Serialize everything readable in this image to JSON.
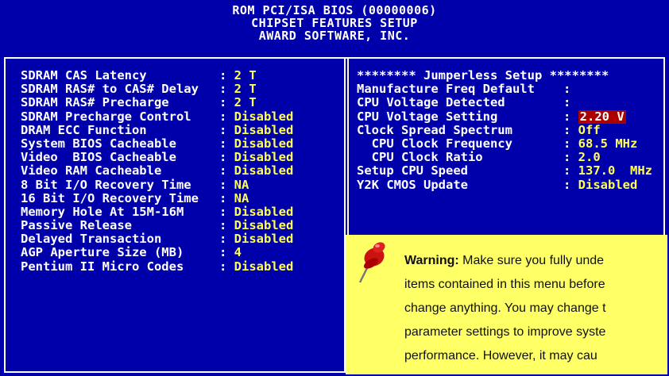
{
  "header": {
    "line1": "ROM PCI/ISA BIOS (00000006)",
    "line2": "CHIPSET FEATURES SETUP",
    "line3": "AWARD SOFTWARE, INC."
  },
  "left_items": [
    {
      "label": "SDRAM CAS Latency",
      "value": "2 T"
    },
    {
      "label": "SDRAM RAS# to CAS# Delay",
      "value": "2 T"
    },
    {
      "label": "SDRAM RAS# Precharge",
      "value": "2 T"
    },
    {
      "label": "SDRAM Precharge Control",
      "value": "Disabled"
    },
    {
      "label": "DRAM ECC Function",
      "value": "Disabled"
    },
    {
      "label": "System BIOS Cacheable",
      "value": "Disabled"
    },
    {
      "label": "Video  BIOS Cacheable",
      "value": "Disabled"
    },
    {
      "label": "Video RAM Cacheable",
      "value": "Disabled"
    },
    {
      "label": "8 Bit I/O Recovery Time",
      "value": "NA"
    },
    {
      "label": "16 Bit I/O Recovery Time",
      "value": "NA"
    },
    {
      "label": "Memory Hole At 15M-16M",
      "value": "Disabled"
    },
    {
      "label": "Passive Release",
      "value": "Disabled"
    },
    {
      "label": "Delayed Transaction",
      "value": "Disabled"
    },
    {
      "label": "AGP Aperture Size (MB)",
      "value": "4"
    },
    {
      "label": "Pentium II Micro Codes",
      "value": "Disabled"
    }
  ],
  "right_items": [
    {
      "label": "******** Jumperless Setup ********",
      "value": ""
    },
    {
      "label": "Manufacture Freq Default",
      "value": ""
    },
    {
      "label": "CPU Voltage Detected",
      "value": ""
    },
    {
      "label": "CPU Voltage Setting",
      "value": "2.20 V"
    },
    {
      "label": "Clock Spread Spectrum",
      "value": "Off"
    },
    {
      "label": "  CPU Clock Frequency",
      "value": "68.5 MHz"
    },
    {
      "label": "  CPU Clock Ratio",
      "value": "2.0"
    },
    {
      "label": "Setup CPU Speed",
      "value": "137.0  MHz"
    },
    {
      "label": "Y2K CMOS Update",
      "value": "Disabled"
    }
  ],
  "warning": {
    "bold": "Warning:",
    "line1": " Make sure you fully unde",
    "line2": "items contained in this menu before",
    "line3": "change anything. You may change t",
    "line4": "parameter settings to improve syste",
    "line5": "performance.    However, it may cau"
  }
}
